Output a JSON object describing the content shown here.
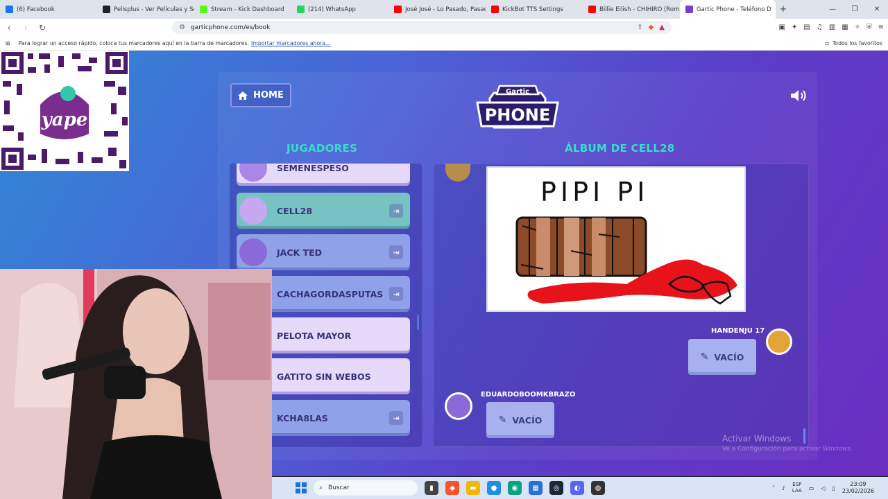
{
  "browser": {
    "tabs": [
      {
        "label": "(6) Facebook",
        "color": "#1877f2"
      },
      {
        "label": "Pelisplus - Ver Películas y Series",
        "color": "#222222"
      },
      {
        "label": "Stream - Kick Dashboard",
        "color": "#53fc18"
      },
      {
        "label": "(214) WhatsApp",
        "color": "#25d366"
      },
      {
        "label": "José José - Lo Pasado, Pasado",
        "color": "#ff0000"
      },
      {
        "label": "KickBot TTS Settings",
        "color": "#ff0000"
      },
      {
        "label": "Billie Eilish - CHIHIRO (Rom",
        "color": "#ff0000"
      },
      {
        "label": "Gartic Phone - Teléfono D",
        "color": "#7a3fd1",
        "active": true
      }
    ],
    "url": "garticphone.com/es/book",
    "bookmarks_hint": "Para lograr un acceso rápido, coloca tus marcadores aquí en la barra de marcadores.",
    "bookmarks_import": "Importar marcadores ahora...",
    "all_bookmarks": "Todos los favoritos"
  },
  "game": {
    "home_label": "HOME",
    "logo_top": "Gartic",
    "logo_bottom": "PHONE",
    "players_title": "JUGADORES",
    "album_title": "ÁLBUM DE CELL28",
    "players": [
      {
        "name": "SEMENESPESO",
        "style": "light",
        "avatar": "#a985e6",
        "kick": false
      },
      {
        "name": "CELL28",
        "style": "hl",
        "avatar": "#c6a8f0",
        "kick": true
      },
      {
        "name": "JACK TED",
        "style": "mid",
        "avatar": "#8a6ad8",
        "kick": true
      },
      {
        "name": "CACHAGORDASPUTAS",
        "style": "mid",
        "avatar": "#6a5ad0",
        "kick": true
      },
      {
        "name": "PELOTA MAYOR",
        "style": "light",
        "avatar": "#b890ee",
        "kick": false
      },
      {
        "name": "GATITO SIN WEBOS",
        "style": "light",
        "avatar": "#b890ee",
        "kick": false
      },
      {
        "name": "KCHA8LAS",
        "style": "mid",
        "avatar": "#7c6cd8",
        "kick": true
      }
    ],
    "drawing_text": "PIPI PI",
    "entries": [
      {
        "author": "HANDENJU 17",
        "label": "VACÍO"
      },
      {
        "author": "EDUARDOBOOMKBRAZO",
        "label": "VACÍO"
      }
    ]
  },
  "windows": {
    "activate_title": "Activar Windows",
    "activate_sub": "Ve a Configuración para activar Windows.",
    "search_placeholder": "Buscar",
    "lang_top": "ESP",
    "lang_bottom": "LAA",
    "time": "23:09",
    "date": "23/02/2026"
  },
  "overlay": {
    "qr_brand": "yape"
  }
}
